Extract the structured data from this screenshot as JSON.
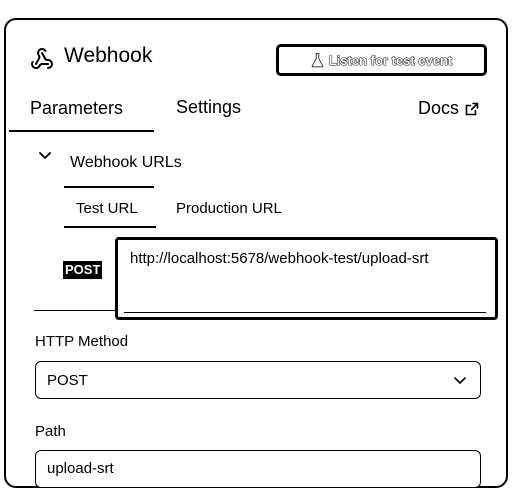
{
  "header": {
    "title": "Webhook",
    "listen_button": "Listen for test event"
  },
  "tabs": {
    "parameters": "Parameters",
    "settings": "Settings",
    "docs": "Docs"
  },
  "webhook_urls": {
    "section_title": "Webhook URLs",
    "test_tab": "Test URL",
    "production_tab": "Production URL",
    "method": "POST",
    "url": "http://localhost:5678/webhook-test/upload-srt"
  },
  "http_method": {
    "label": "HTTP Method",
    "value": "POST"
  },
  "path": {
    "label": "Path",
    "value": "upload-srt"
  }
}
